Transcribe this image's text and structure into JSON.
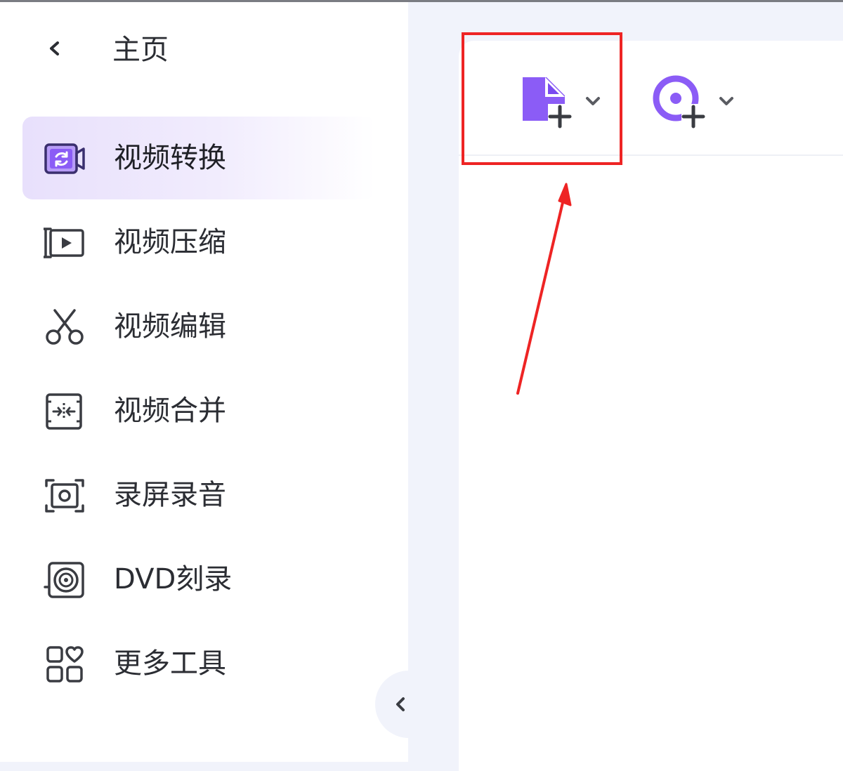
{
  "sidebar": {
    "back_label": "主页",
    "items": [
      {
        "label": "视频转换",
        "icon": "video-convert-icon",
        "active": true
      },
      {
        "label": "视频压缩",
        "icon": "video-compress-icon",
        "active": false
      },
      {
        "label": "视频编辑",
        "icon": "scissors-icon",
        "active": false
      },
      {
        "label": "视频合并",
        "icon": "merge-icon",
        "active": false
      },
      {
        "label": "录屏录音",
        "icon": "screen-record-icon",
        "active": false
      },
      {
        "label": "DVD刻录",
        "icon": "disc-icon",
        "active": false
      },
      {
        "label": "更多工具",
        "icon": "grid-heart-icon",
        "active": false
      }
    ]
  },
  "toolbar": {
    "add_file_icon": "add-file-icon",
    "add_disc_icon": "add-disc-icon"
  },
  "colors": {
    "accent": "#8b5cf6",
    "accent_dark": "#6d3fe0",
    "active_bg": "#ebe4fc",
    "annotation_red": "#ee2424",
    "page_bg": "#f1f3fb"
  }
}
